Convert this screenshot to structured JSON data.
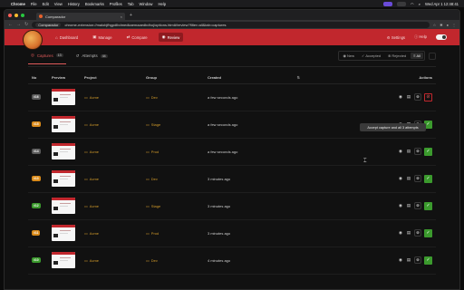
{
  "menubar": {
    "apple": "",
    "app": "Chrome",
    "items": [
      "File",
      "Edit",
      "View",
      "History",
      "Bookmarks",
      "Profiles",
      "Tab",
      "Window",
      "Help"
    ],
    "clock": "Wed Apr 1 12:48:41"
  },
  "browser": {
    "tab_title": "Comparador",
    "new_tab": "+",
    "chip": "Comparador",
    "url": "chrome-extension://malobjfhgpdlbdmedkaemaaedbdhoj/options.html#/review?filter=all&tab=captures"
  },
  "app": {
    "nav": [
      {
        "label": "Dashboard",
        "icon": "⌂"
      },
      {
        "label": "Manage",
        "icon": "▣"
      },
      {
        "label": "Compare",
        "icon": "⇄"
      },
      {
        "label": "Review",
        "icon": "◉"
      }
    ],
    "settings": "Settings",
    "help": "Help"
  },
  "subbar": {
    "tabs": [
      {
        "label": "Captures",
        "count": "13"
      },
      {
        "label": "Attempts",
        "count": "44"
      }
    ],
    "filters": [
      "New",
      "Accepted",
      "Rejected",
      "All"
    ]
  },
  "table": {
    "headers": {
      "no": "No",
      "preview": "Preview",
      "project": "Project",
      "group": "Group",
      "created": "Created",
      "actions": "Actions"
    },
    "rows": [
      {
        "no": "#16",
        "badge_color": "#5a5a5a",
        "project": "Acme",
        "group": "Dev",
        "created": "a few seconds ago"
      },
      {
        "no": "#15",
        "badge_color": "#d98a1a",
        "project": "Acme",
        "group": "Stage",
        "created": "a few seconds ago"
      },
      {
        "no": "#14",
        "badge_color": "#5a5a5a",
        "project": "Acme",
        "group": "Prod",
        "created": "a few seconds ago"
      },
      {
        "no": "#13",
        "badge_color": "#d98a1a",
        "project": "Acme",
        "group": "Dev",
        "created": "3 minutes ago"
      },
      {
        "no": "#12",
        "badge_color": "#3b9a2d",
        "project": "Acme",
        "group": "Stage",
        "created": "3 minutes ago"
      },
      {
        "no": "#11",
        "badge_color": "#d98a1a",
        "project": "Acme",
        "group": "Prod",
        "created": "3 minutes ago"
      },
      {
        "no": "#10",
        "badge_color": "#3b9a2d",
        "project": "Acme",
        "group": "Dev",
        "created": "4 minutes ago"
      }
    ]
  },
  "tooltip": "Accept capture and all 3 attempts"
}
